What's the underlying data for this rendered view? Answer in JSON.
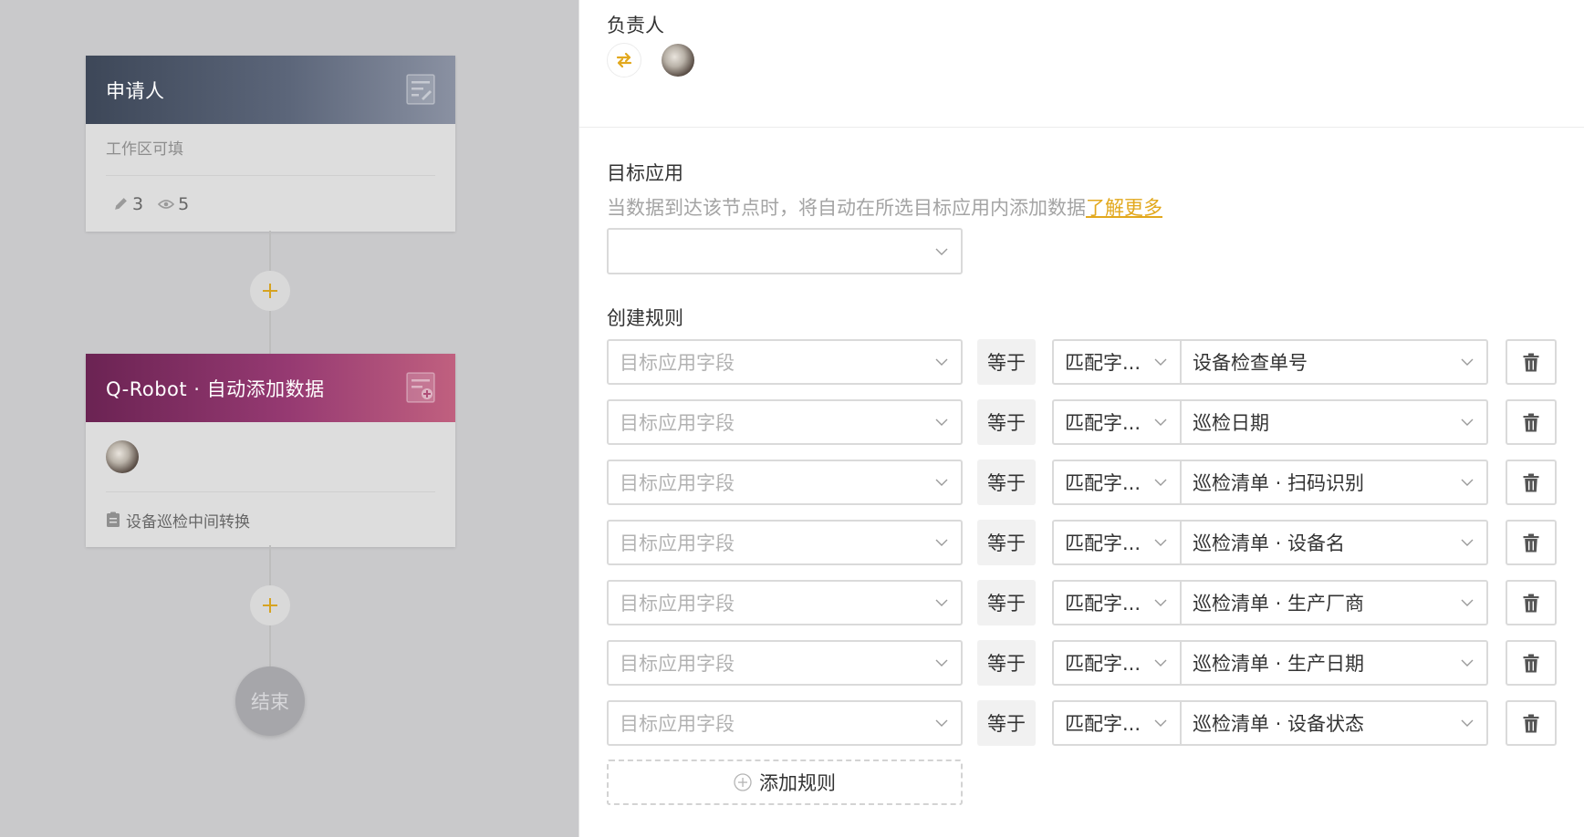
{
  "flow": {
    "card1": {
      "title": "申请人",
      "subtitle": "工作区可填",
      "edit_count": "3",
      "view_count": "5"
    },
    "card2": {
      "title": "Q-Robot · 自动添加数据",
      "footer": "设备巡检中间转换"
    },
    "end_label": "结束"
  },
  "panel": {
    "owner_title": "负责人",
    "target_title": "目标应用",
    "target_desc": "当数据到达该节点时，将自动在所选目标应用内添加数据",
    "learn_more": "了解更多",
    "target_select_value": "",
    "rules_title": "创建规则",
    "add_rule_label": "添加规则",
    "rules": [
      {
        "field_placeholder": "目标应用字段",
        "op": "等于",
        "mode": "匹配字...",
        "value": "设备检查单号"
      },
      {
        "field_placeholder": "目标应用字段",
        "op": "等于",
        "mode": "匹配字...",
        "value": "巡检日期"
      },
      {
        "field_placeholder": "目标应用字段",
        "op": "等于",
        "mode": "匹配字...",
        "value": "巡检清单 · 扫码识别"
      },
      {
        "field_placeholder": "目标应用字段",
        "op": "等于",
        "mode": "匹配字...",
        "value": "巡检清单 · 设备名"
      },
      {
        "field_placeholder": "目标应用字段",
        "op": "等于",
        "mode": "匹配字...",
        "value": "巡检清单 · 生产厂商"
      },
      {
        "field_placeholder": "目标应用字段",
        "op": "等于",
        "mode": "匹配字...",
        "value": "巡检清单 · 生产日期"
      },
      {
        "field_placeholder": "目标应用字段",
        "op": "等于",
        "mode": "匹配字...",
        "value": "巡检清单 · 设备状态"
      }
    ]
  },
  "colors": {
    "accent": "#e2a81d",
    "card1_head": "#4a5366",
    "card2_head": "#8a2f63"
  }
}
